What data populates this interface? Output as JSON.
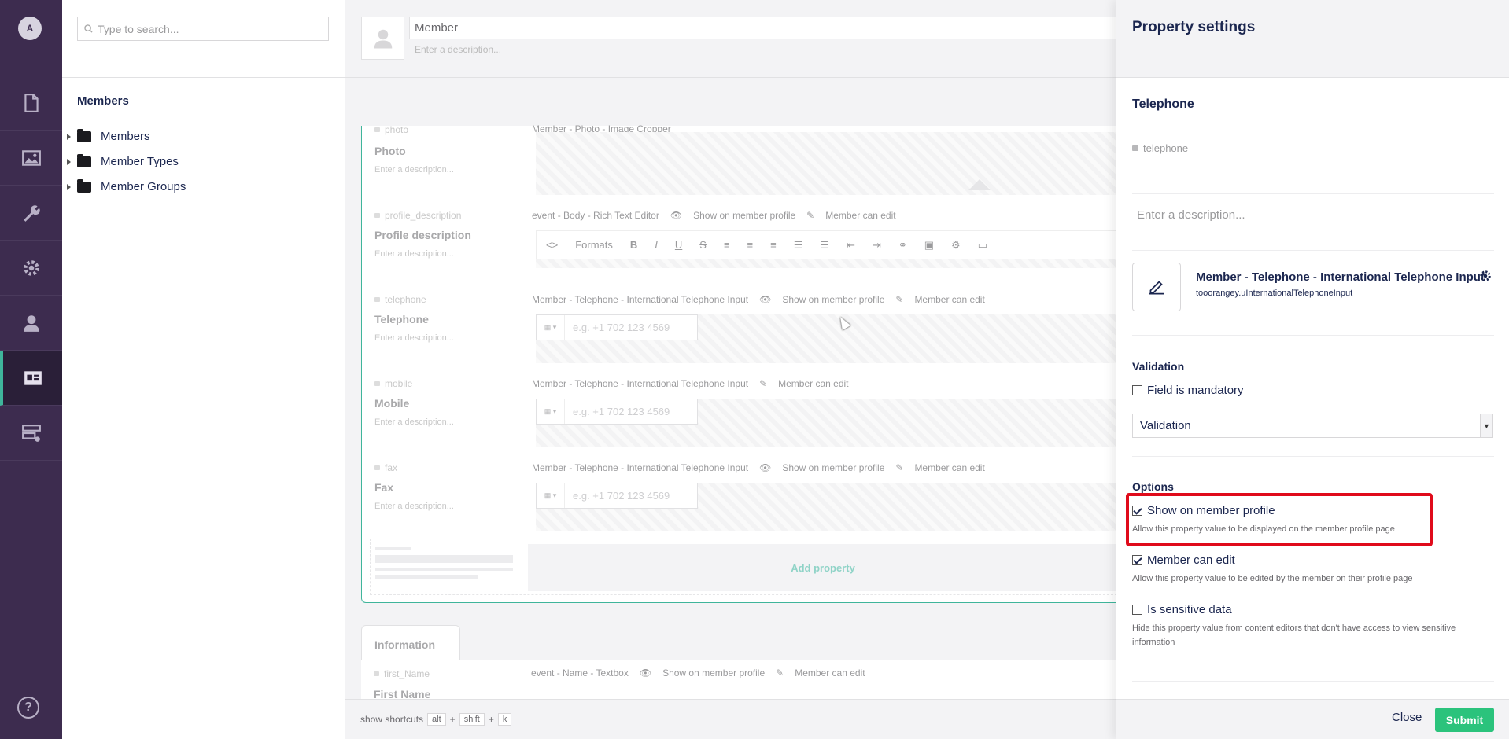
{
  "rail": {
    "avatar_initial": "A",
    "items": [
      {
        "icon": "content-icon"
      },
      {
        "icon": "media-icon"
      },
      {
        "icon": "settings-wrench-icon"
      },
      {
        "icon": "gear-icon"
      },
      {
        "icon": "users-icon"
      },
      {
        "icon": "members-icon",
        "active": true
      },
      {
        "icon": "forms-icon"
      }
    ],
    "help_label": "?"
  },
  "tree": {
    "search_placeholder": "Type to search...",
    "title": "Members",
    "items": [
      {
        "label": "Members"
      },
      {
        "label": "Member Types"
      },
      {
        "label": "Member Groups"
      }
    ]
  },
  "editor": {
    "name": "Member",
    "description_placeholder": "Enter a description...",
    "properties": [
      {
        "alias": "photo",
        "label": "Photo",
        "description": "Enter a description...",
        "meta": [
          "Member - Photo - Image Cropper"
        ]
      },
      {
        "alias": "profile_description",
        "label": "Profile description",
        "description": "Enter a description...",
        "meta": [
          "event - Body - Rich Text Editor",
          "Show on member profile",
          "Member can edit"
        ],
        "rte_formats": "Formats"
      },
      {
        "alias": "telephone",
        "label": "Telephone",
        "description": "Enter a description...",
        "meta": [
          "Member - Telephone - International Telephone Input",
          "Show on member profile",
          "Member can edit"
        ],
        "placeholder": "e.g. +1 702 123 4569"
      },
      {
        "alias": "mobile",
        "label": "Mobile",
        "description": "Enter a description...",
        "meta": [
          "Member - Telephone - International Telephone Input",
          "Member can edit"
        ],
        "placeholder": "e.g. +1 702 123 4569"
      },
      {
        "alias": "fax",
        "label": "Fax",
        "description": "Enter a description...",
        "meta": [
          "Member - Telephone - International Telephone Input",
          "Show on member profile",
          "Member can edit"
        ],
        "placeholder": "e.g. +1 702 123 4569"
      }
    ],
    "add_property": "Add property",
    "info_tab": "Information",
    "info_prop": {
      "alias": "first_Name",
      "label": "First Name",
      "meta": [
        "event - Name - Textbox",
        "Show on member profile",
        "Member can edit"
      ]
    },
    "footer": {
      "label": "show shortcuts",
      "keys": [
        "alt",
        "shift",
        "k"
      ],
      "plus": "+"
    }
  },
  "panel": {
    "title": "Property settings",
    "name": "Telephone",
    "alias": "telephone",
    "description_placeholder": "Enter a description...",
    "editor_name": "Member - Telephone - International Telephone Input",
    "editor_alias": "tooorangey.uInternationalTelephoneInput",
    "validation": {
      "title": "Validation",
      "mandatory_label": "Field is mandatory",
      "mandatory_checked": false,
      "select_value": "Validation"
    },
    "options": {
      "title": "Options",
      "items": [
        {
          "label": "Show on member profile",
          "help": "Allow this property value to be displayed on the member profile page",
          "checked": true
        },
        {
          "label": "Member can edit",
          "help": "Allow this property value to be edited by the member on their profile page",
          "checked": true
        },
        {
          "label": "Is sensitive data",
          "help": "Hide this property value from content editors that don't have access to view sensitive information",
          "checked": false
        }
      ]
    },
    "close_label": "Close",
    "submit_label": "Submit"
  },
  "colors": {
    "rail": "#3d2c4f",
    "accent": "#3fb59b",
    "submit": "#2bc37c",
    "highlight": "#e00b1b"
  }
}
